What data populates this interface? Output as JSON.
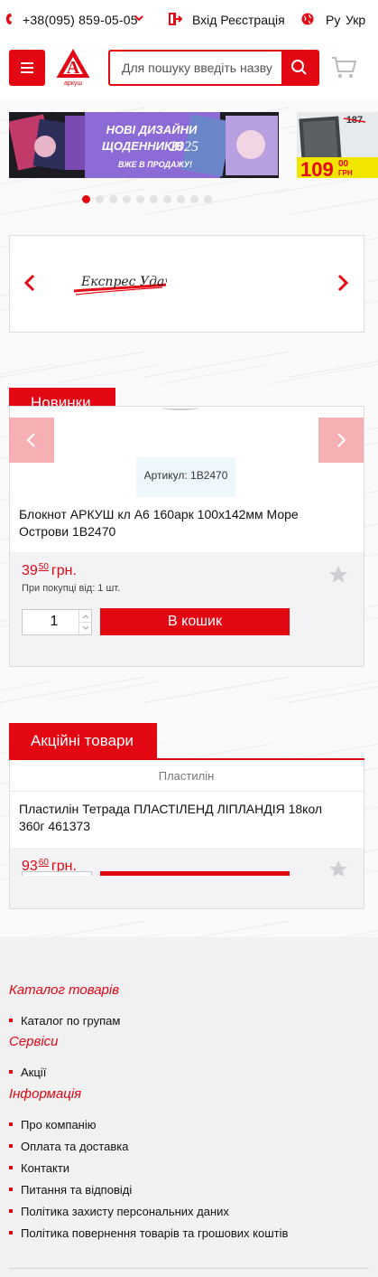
{
  "topbar": {
    "phone": "+38(095) 859-05-05",
    "login": "Вхід",
    "register": "Реєстрація",
    "lang_ru": "Ру",
    "lang_uk": "Укр"
  },
  "header": {
    "logo_text": "аркуш",
    "search_placeholder": "Для пошуку введіть назву",
    "menu_icon": "hamburger-icon",
    "cart_icon": "cart-icon"
  },
  "banners": {
    "main": {
      "line1": "НОВІ ДИЗАЙНИ",
      "line2": "ЩОДЕННИКІВ",
      "year": "2025",
      "line3": "ВЖЕ В ПРОДАЖУ!"
    },
    "side": {
      "old_price": "187",
      "price_main": "109",
      "price_cents": "00",
      "price_unit": "ГРН"
    },
    "dots_count": 10,
    "active_dot": 0
  },
  "brands": {
    "logo_text": "Експрес Удачі"
  },
  "new_items": {
    "title": "Новинки",
    "product": {
      "sku": "Артикул: 1В2470",
      "name": "Блокнот АРКУШ кл А6 160арк 100х142мм Море Острови 1В2470",
      "price_main": "39",
      "price_cents": "50",
      "currency": "грн.",
      "min_qty": "При покупці від: 1 шт.",
      "qty": "1",
      "cart_button": "В кошик"
    }
  },
  "promo_items": {
    "title": "Акційні товари",
    "product": {
      "category": "Пластилін",
      "name": "Пластилін Тетрада ПЛАСТІЛЕНД ЛІПЛАНДІЯ 18кол 360г 461373",
      "price_main": "93",
      "price_cents": "60",
      "currency": "грн."
    }
  },
  "footer": {
    "catalog_title": "Каталог товарів",
    "catalog_items": [
      "Каталог по групам"
    ],
    "services_title": "Сервіси",
    "services_items": [
      "Акції"
    ],
    "info_title": "Інформація",
    "info_items": [
      "Про компанію",
      "Оплата та доставка",
      "Контакти",
      "Питання та відповіді",
      "Політика захисту персональних даних",
      "Політика повернення товарів та грошових коштів"
    ]
  },
  "colors": {
    "accent": "#e30613",
    "footer_bg": "#f1f1f1"
  }
}
